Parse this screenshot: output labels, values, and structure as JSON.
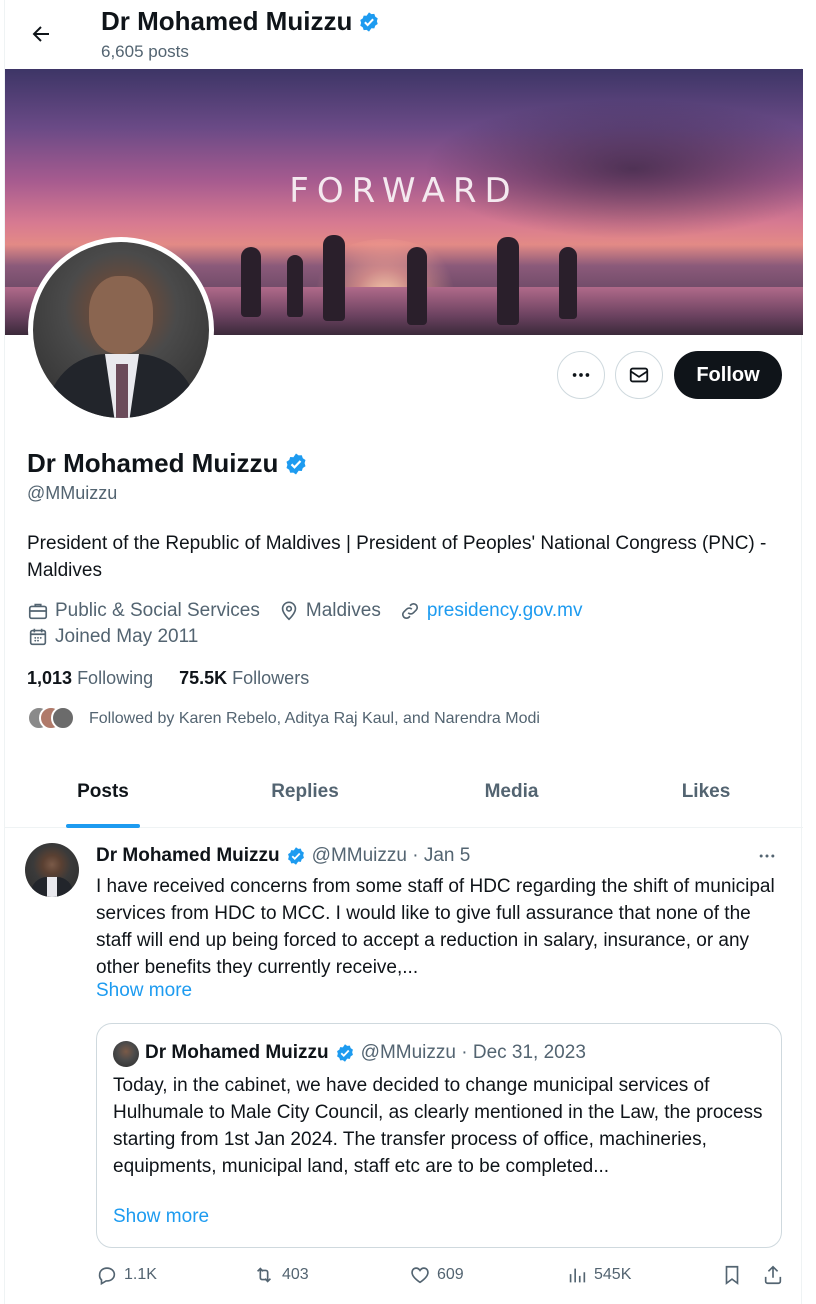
{
  "header": {
    "name": "Dr Mohamed Muizzu",
    "post_count": "6,605 posts"
  },
  "banner": {
    "text": "FORWARD"
  },
  "profile": {
    "name": "Dr Mohamed Muizzu",
    "handle": "@MMuizzu",
    "bio": "President of the Republic of Maldives | President of Peoples' National Congress (PNC) - Maldives",
    "category": "Public & Social Services",
    "location": "Maldives",
    "website": "presidency.gov.mv",
    "joined": "Joined May 2011",
    "following_count": "1,013",
    "following_label": "Following",
    "followers_count": "75.5K",
    "followers_label": "Followers",
    "followed_by": "Followed by Karen Rebelo, Aditya Raj Kaul, and Narendra Modi",
    "follow_label": "Follow"
  },
  "tabs": [
    {
      "label": "Posts",
      "active": true
    },
    {
      "label": "Replies"
    },
    {
      "label": "Media"
    },
    {
      "label": "Likes"
    }
  ],
  "tweet": {
    "name": "Dr Mohamed Muizzu",
    "handle_date": "@MMuizzu · Jan 5",
    "text": "I have received concerns from some staff of HDC regarding the shift of municipal services from HDC to MCC. I would like to give full assurance that none of the staff will end up being forced to accept a reduction in salary, insurance, or any other benefits they currently receive,...",
    "show_more": "Show more",
    "quote": {
      "name": "Dr Mohamed Muizzu",
      "handle_date": "@MMuizzu · Dec 31, 2023",
      "text": "Today, in the cabinet, we have decided to change municipal services of Hulhumale to Male City Council, as clearly mentioned in the Law, the process starting from 1st Jan 2024. The transfer process of office, machineries, equipments, municipal land, staff etc are to be completed...",
      "show_more": "Show more"
    },
    "stats": {
      "replies": "1.1K",
      "reposts": "403",
      "likes": "609",
      "views": "545K"
    }
  },
  "colors": {
    "accent": "#1d9bf0",
    "text": "#0f1419",
    "muted": "#536471",
    "border": "#cfd9de"
  },
  "icons": [
    "back-arrow-icon",
    "verified-badge-icon",
    "more-icon",
    "message-icon",
    "briefcase-icon",
    "location-pin-icon",
    "link-icon",
    "calendar-icon",
    "reply-icon",
    "repost-icon",
    "like-icon",
    "views-icon",
    "bookmark-icon",
    "share-icon"
  ]
}
